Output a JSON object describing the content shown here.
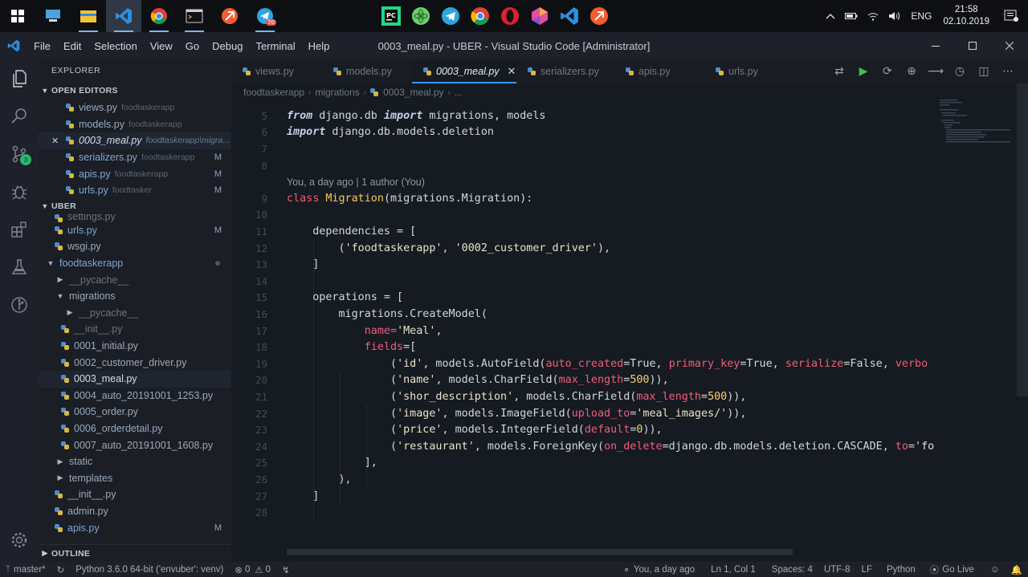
{
  "taskbar": {
    "left_apps": [
      {
        "name": "start-icon",
        "label": "",
        "color": "#ffffff"
      },
      {
        "name": "computer-icon",
        "label": "",
        "color": "#4aa3df"
      },
      {
        "name": "file-explorer-icon",
        "label": "",
        "color": "#f3c339"
      },
      {
        "name": "vscode-taskbar-icon",
        "label": "",
        "color": "#2d8fe0"
      },
      {
        "name": "chrome-taskbar-icon",
        "label": "",
        "color": "#4caf50"
      },
      {
        "name": "terminal-taskbar-icon",
        "label": "",
        "color": "#cccccc"
      },
      {
        "name": "git-taskbar-icon",
        "label": "",
        "color": "#f25c30"
      },
      {
        "name": "telegram-taskbar-icon",
        "label": "",
        "color": "#2ca5e0"
      }
    ],
    "telegram_badge": "70",
    "center_apps": [
      "pycharm-icon",
      "atom-icon",
      "telegram-icon",
      "chrome-icon",
      "opera-icon",
      "gem-icon",
      "vscode-icon",
      "git-icon"
    ],
    "language": "ENG",
    "time": "21:58",
    "date": "02.10.2019"
  },
  "titlebar": {
    "menu": [
      "File",
      "Edit",
      "Selection",
      "View",
      "Go",
      "Debug",
      "Terminal",
      "Help"
    ],
    "title": "0003_meal.py - UBER - Visual Studio Code [Administrator]"
  },
  "activity": {
    "scm_badge": "3"
  },
  "sidebar": {
    "title": "EXPLORER",
    "open_editors_label": "OPEN EDITORS",
    "open_editors": [
      {
        "name": "views.py",
        "desc": "foodtaskerapp",
        "status": ""
      },
      {
        "name": "models.py",
        "desc": "foodtaskerapp",
        "status": ""
      },
      {
        "name": "0003_meal.py",
        "desc": "foodtaskerapp\\migra...",
        "status": ""
      },
      {
        "name": "serializers.py",
        "desc": "foodtaskerapp",
        "status": "M"
      },
      {
        "name": "apis.py",
        "desc": "foodtaskerapp",
        "status": "M"
      },
      {
        "name": "urls.py",
        "desc": "foodtasker",
        "status": "M"
      }
    ],
    "workspace_label": "UBER",
    "tree": [
      {
        "name": "settings.py",
        "status": ""
      },
      {
        "name": "urls.py",
        "status": "M"
      },
      {
        "name": "wsgi.py",
        "status": ""
      },
      {
        "name": "foodtaskerapp",
        "status": ""
      },
      {
        "name": "__pycache__",
        "status": ""
      },
      {
        "name": "migrations",
        "status": ""
      },
      {
        "name": "__pycache__",
        "status": ""
      },
      {
        "name": "__init__.py",
        "status": ""
      },
      {
        "name": "0001_initial.py",
        "status": ""
      },
      {
        "name": "0002_customer_driver.py",
        "status": ""
      },
      {
        "name": "0003_meal.py",
        "status": ""
      },
      {
        "name": "0004_auto_20191001_1253.py",
        "status": ""
      },
      {
        "name": "0005_order.py",
        "status": ""
      },
      {
        "name": "0006_orderdetail.py",
        "status": ""
      },
      {
        "name": "0007_auto_20191001_1608.py",
        "status": ""
      },
      {
        "name": "static",
        "status": ""
      },
      {
        "name": "templates",
        "status": ""
      },
      {
        "name": "__init__.py",
        "status": ""
      },
      {
        "name": "admin.py",
        "status": ""
      },
      {
        "name": "apis.py",
        "status": "M"
      }
    ],
    "outline_label": "OUTLINE"
  },
  "editor": {
    "tabs": [
      "views.py",
      "models.py",
      "0003_meal.py",
      "serializers.py",
      "apis.py",
      "urls.py"
    ],
    "breadcrumbs": [
      "foodtaskerapp",
      "migrations",
      "0003_meal.py",
      "..."
    ],
    "blame": "You, a day ago | 1 author (You)",
    "line_numbers": [
      "5",
      "6",
      "7",
      "8",
      "9",
      "10",
      "11",
      "12",
      "13",
      "14",
      "15",
      "16",
      "17",
      "18",
      "19",
      "20",
      "21",
      "22",
      "23",
      "24",
      "25",
      "26",
      "27",
      "28"
    ]
  },
  "code": {
    "l5_kw1": "from",
    "l5_a": " django.db ",
    "l5_kw2": "import",
    "l5_b": " migrations, models",
    "l6_kw": "import",
    "l6_a": " django.db.models.deletion",
    "l9_kw": "class",
    "l9_cls": "Migration",
    "l9_a": "(migrations.Migration):",
    "l11": "    dependencies = [",
    "l12_a": "        (",
    "l12_s1": "'foodtaskerapp'",
    "l12_b": ", ",
    "l12_s2": "'0002_customer_driver'",
    "l12_c": "),",
    "l13": "    ]",
    "l15": "    operations = [",
    "l16": "        migrations.CreateModel(",
    "l17_a": "            ",
    "l17_arg": "name",
    "l17_eq": "=",
    "l17_s": "'Meal'",
    "l17_c": ",",
    "l18_a": "            ",
    "l18_arg": "fields",
    "l18_eq": "=[",
    "l19_a": "                (",
    "l19_s": "'id'",
    "l19_b": ", models.AutoField(",
    "l19_k1": "auto_created",
    "l19_e1": "=True, ",
    "l19_k2": "primary_key",
    "l19_e2": "=True, ",
    "l19_k3": "serialize",
    "l19_e3": "=False, ",
    "l19_k4": "verbo",
    "l20_a": "                (",
    "l20_s": "'name'",
    "l20_b": ", models.CharField(",
    "l20_k": "max_length",
    "l20_e": "=",
    "l20_n": "500",
    "l20_c": ")),",
    "l21_a": "                (",
    "l21_s": "'shor_description'",
    "l21_b": ", models.CharField(",
    "l21_k": "max_length",
    "l21_e": "=",
    "l21_n": "500",
    "l21_c": ")),",
    "l22_a": "                (",
    "l22_s": "'image'",
    "l22_b": ", models.ImageField(",
    "l22_k": "upload_to",
    "l22_e": "=",
    "l22_v": "'meal_images/'",
    "l22_c": ")),",
    "l23_a": "                (",
    "l23_s": "'price'",
    "l23_b": ", models.IntegerField(",
    "l23_k": "default",
    "l23_e": "=",
    "l23_n": "0",
    "l23_c": ")),",
    "l24_a": "                (",
    "l24_s": "'restaurant'",
    "l24_b": ", models.ForeignKey(",
    "l24_k": "on_delete",
    "l24_e": "=django.db.models.deletion.CASCADE, ",
    "l24_k2": "to",
    "l24_e2": "=",
    "l24_v": "'fo",
    "l25": "            ],",
    "l26": "        ),",
    "l27": "    ]"
  },
  "statusbar": {
    "branch": "master*",
    "python": "Python 3.6.0 64-bit ('envuber': venv)",
    "errors": "0",
    "warnings": "0",
    "blame": "You, a day ago",
    "position": "Ln 1, Col 1",
    "spaces": "Spaces: 4",
    "encoding": "UTF-8",
    "eol": "LF",
    "language": "Python",
    "golive": "Go Live"
  },
  "colors": {
    "accent": "#3794ff",
    "keyword": "#f25c7b",
    "class_name": "#f2c95c",
    "scm_badge": "#2bb673"
  }
}
